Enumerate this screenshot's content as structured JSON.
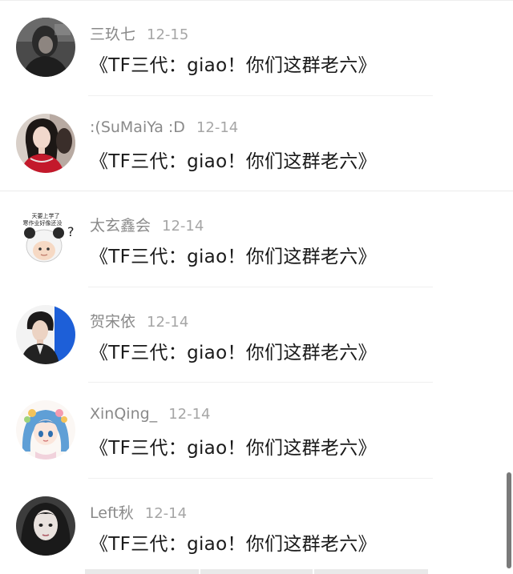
{
  "comments": [
    {
      "username": "三玖七",
      "date": "12-15",
      "text": "《TF三代：giao！你们这群老六》",
      "avatar_icon": "avatar-dark-photo"
    },
    {
      "username": ":(SuMaiYa :D",
      "date": "12-14",
      "text": "《TF三代：giao！你们这群老六》",
      "avatar_icon": "avatar-woman-red-dress"
    },
    {
      "username": "太玄鑫会",
      "date": "12-14",
      "text": "《TF三代：giao！你们这群老六》",
      "avatar_icon": "avatar-panda-meme"
    },
    {
      "username": "贺宋依",
      "date": "12-14",
      "text": "《TF三代：giao！你们这群老六》",
      "avatar_icon": "avatar-boy-blue-background"
    },
    {
      "username": "XinQing_",
      "date": "12-14",
      "text": "《TF三代：giao！你们这群老六》",
      "avatar_icon": "avatar-anime-girl-blue-hair"
    },
    {
      "username": "Left秋",
      "date": "12-14",
      "text": "《TF三代：giao！你们这群老六》",
      "avatar_icon": "avatar-girl-dark-hair"
    }
  ],
  "avatar_text": {
    "panda_caption_line1": "天要上学了",
    "panda_caption_line2": "寒作业好像还没",
    "panda_question": "?"
  },
  "colors": {
    "username": "#8a8a8a",
    "date": "#a6a6a6",
    "content": "#1a1a1a",
    "divider": "#f0f0f0",
    "scrollbar": "#7a7a7a"
  }
}
